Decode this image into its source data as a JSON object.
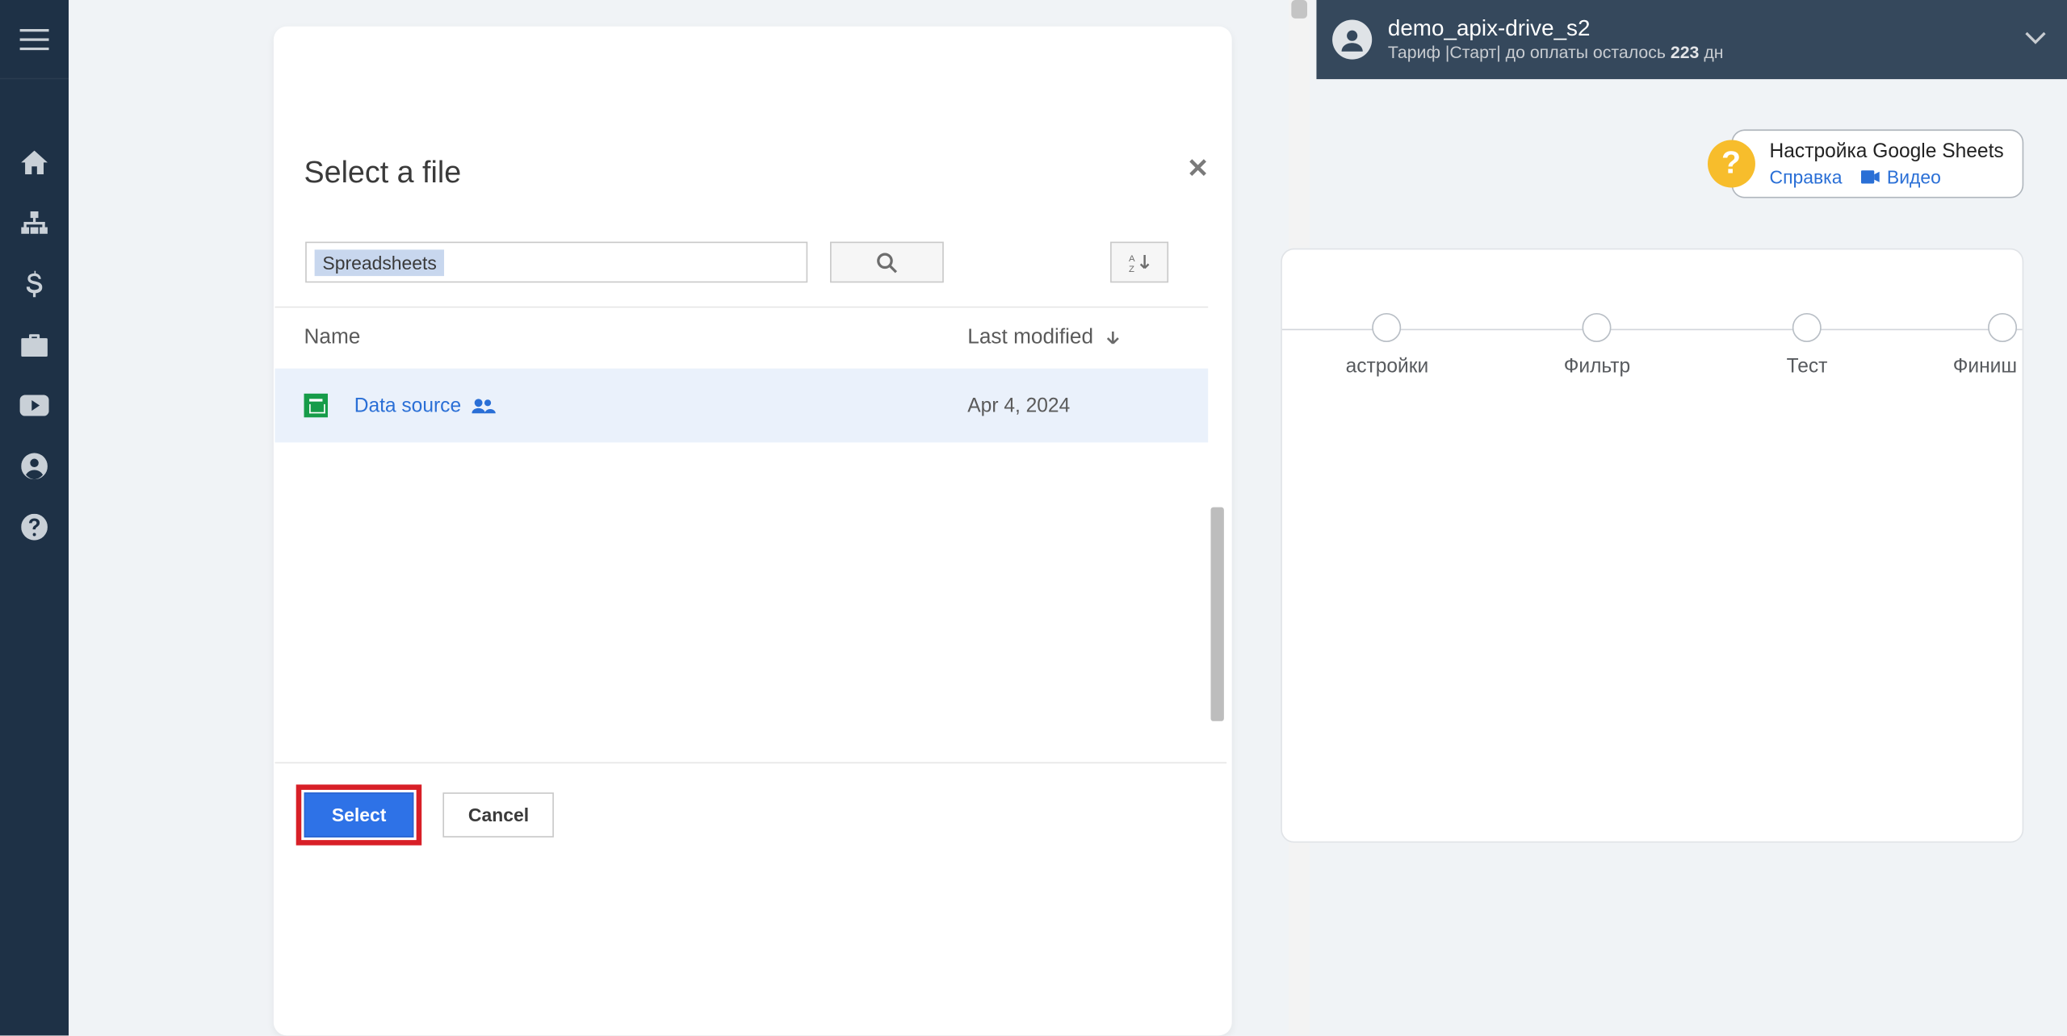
{
  "header": {
    "username": "demo_apix-drive_s2",
    "tariff_prefix": "Тариф |Старт| до оплаты осталось ",
    "tariff_days": "223",
    "tariff_suffix": " дн"
  },
  "help": {
    "title": "Настройка Google Sheets",
    "link_help": "Справка",
    "link_video": "Видео"
  },
  "steps": {
    "items": [
      {
        "label": "астройки"
      },
      {
        "label": "Фильтр"
      },
      {
        "label": "Тест"
      },
      {
        "label": "Финиш"
      }
    ]
  },
  "picker": {
    "title": "Select a file",
    "filter_chip": "Spreadsheets",
    "columns": {
      "name": "Name",
      "modified": "Last modified"
    },
    "files": [
      {
        "name": "Data source",
        "modified": "Apr 4, 2024"
      }
    ],
    "select_label": "Select",
    "cancel_label": "Cancel"
  }
}
